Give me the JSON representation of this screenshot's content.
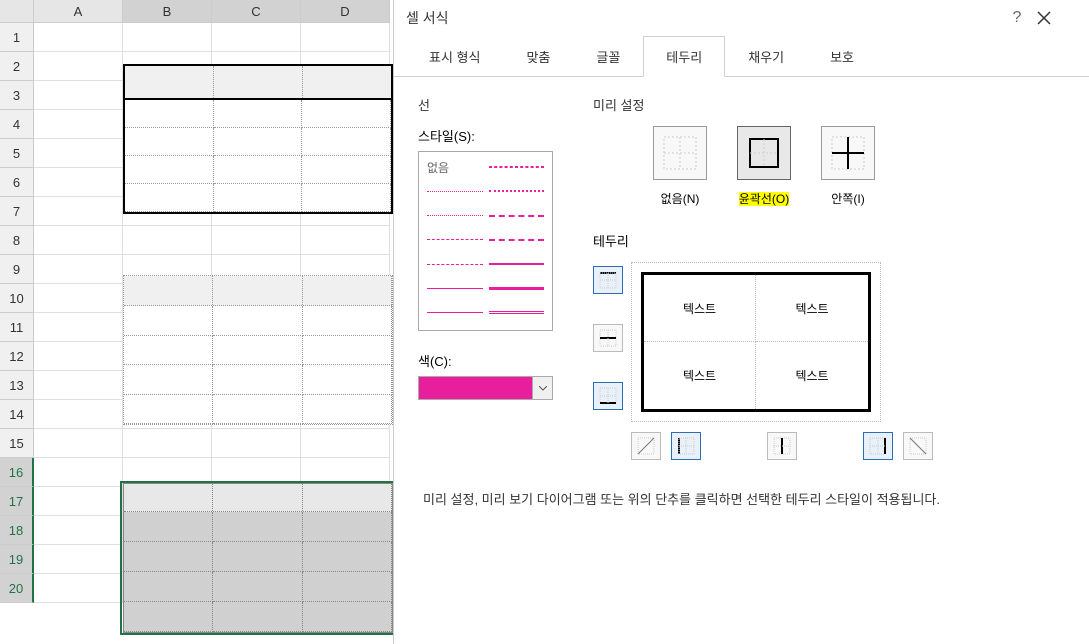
{
  "sheet": {
    "columns": [
      "A",
      "B",
      "C",
      "D"
    ],
    "row_count": 20
  },
  "dialog": {
    "title": "셀 서식",
    "tabs": [
      "표시 형식",
      "맞춤",
      "글꼴",
      "테두리",
      "채우기",
      "보호"
    ],
    "active_tab": 3,
    "line_group": "선",
    "style_label": "스타일(S):",
    "style_none": "없음",
    "color_label": "색(C):",
    "preview_group": "미리 설정",
    "presets": {
      "none": "없음(N)",
      "outline": "윤곽선(O)",
      "inside": "안쪽(I)"
    },
    "border_label": "테두리",
    "preview_text": "텍스트",
    "hint": "미리 설정, 미리 보기 다이어그램 또는 위의 단추를 클릭하면 선택한 테두리 스타일이 적용됩니다."
  }
}
